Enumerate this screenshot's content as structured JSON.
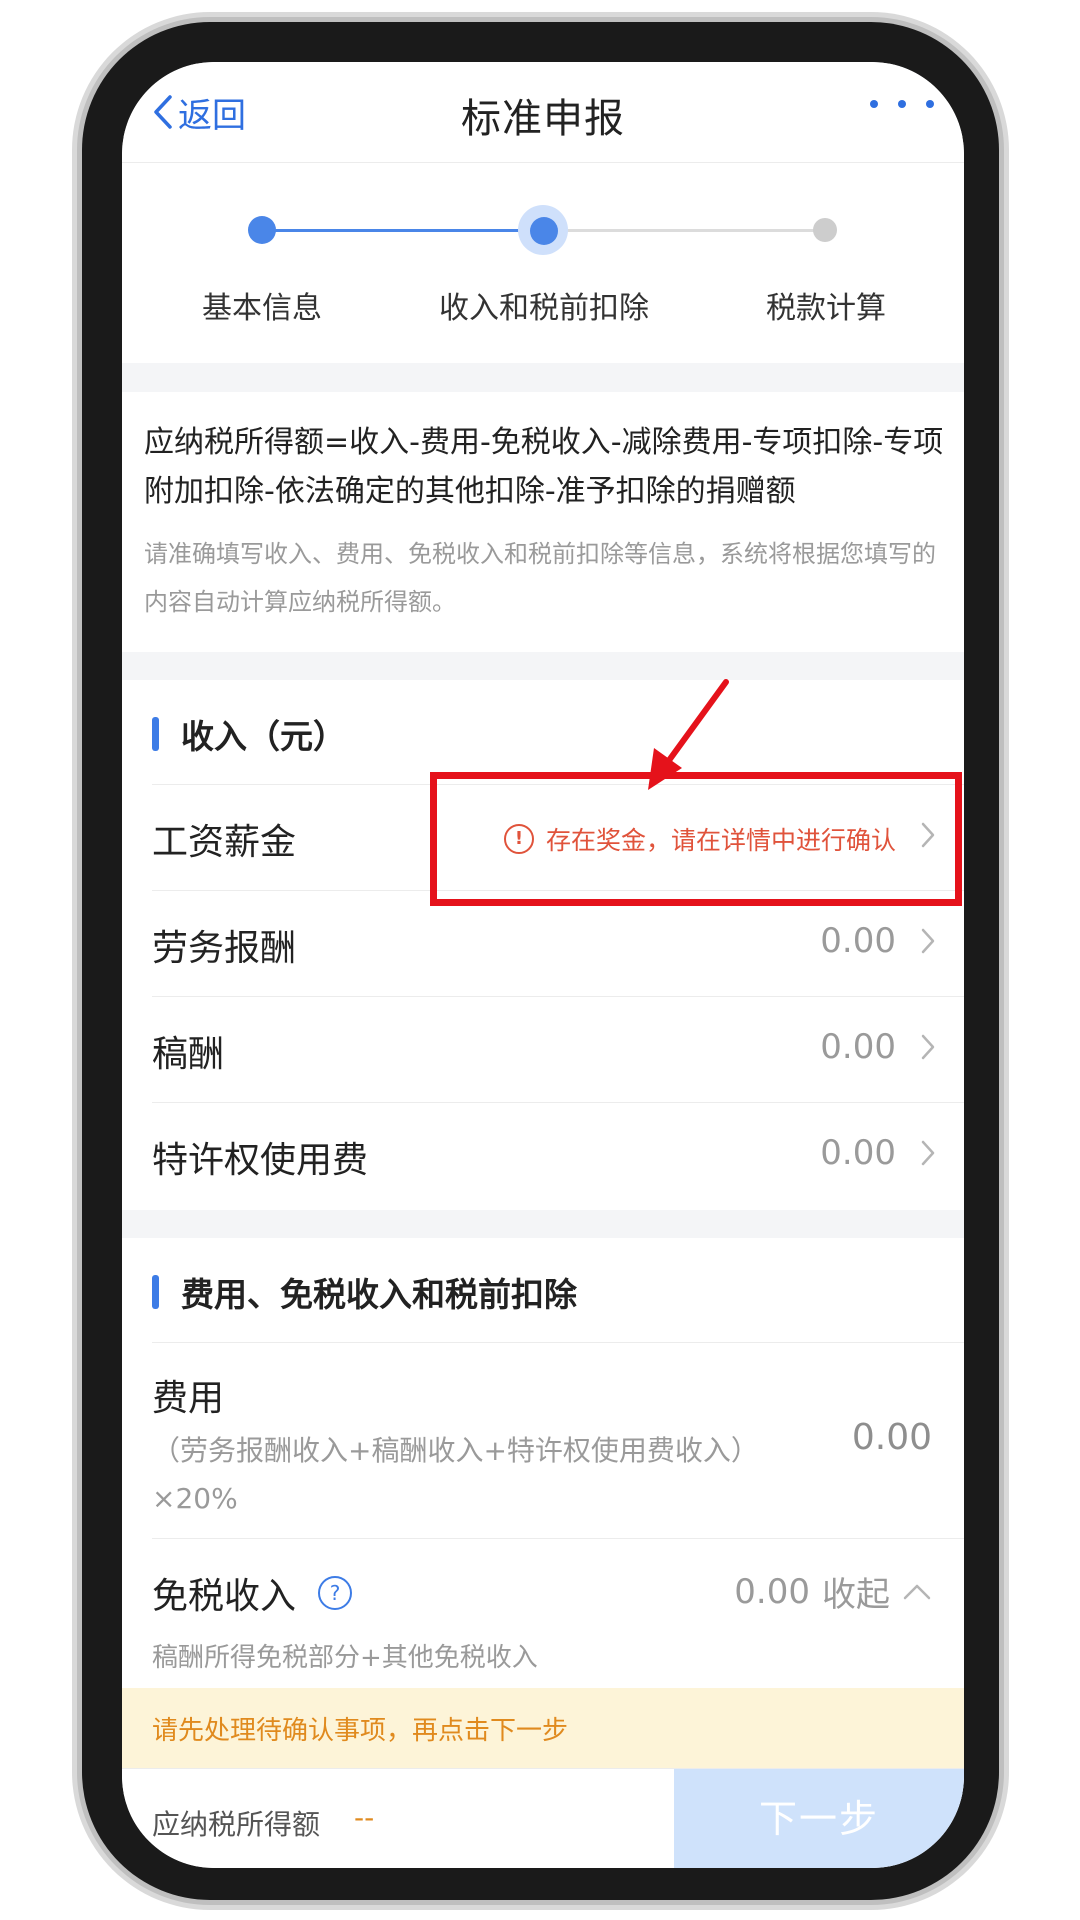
{
  "header": {
    "back_label": "返回",
    "title": "标准申报"
  },
  "stepper": {
    "steps": [
      "基本信息",
      "收入和税前扣除",
      "税款计算"
    ],
    "current_step": 2
  },
  "formula": {
    "text": "应纳税所得额=收入-费用-免税收入-减除费用-专项扣除-专项附加扣除-依法确定的其他扣除-准予扣除的捐赠额",
    "hint": "请准确填写收入、费用、免税收入和税前扣除等信息，系统将根据您填写的内容自动计算应纳税所得额。"
  },
  "income": {
    "title": "收入（元）",
    "rows": [
      {
        "label": "工资薪金",
        "warning": "存在奖金，请在详情中进行确认"
      },
      {
        "label": "劳务报酬",
        "value": "0.00"
      },
      {
        "label": "稿酬",
        "value": "0.00"
      },
      {
        "label": "特许权使用费",
        "value": "0.00"
      }
    ]
  },
  "deduction": {
    "title": "费用、免税收入和税前扣除",
    "fee": {
      "label": "费用",
      "sub": "（劳务报酬收入+稿酬收入+特许权使用费收入）×20%",
      "value": "0.00"
    },
    "tax_free": {
      "label": "免税收入",
      "value": "0.00",
      "toggle": "收起",
      "sub": "稿酬所得免税部分+其他免税收入"
    }
  },
  "notice": {
    "text": "请先处理待确认事项，再点击下一步"
  },
  "bottom": {
    "label": "应纳税所得额",
    "value": "--",
    "next": "下一步"
  },
  "colors": {
    "accent": "#3d7ce6",
    "warning": "#e0533b",
    "highlight": "#e5121b",
    "notice_bg": "#fdf4d8"
  }
}
